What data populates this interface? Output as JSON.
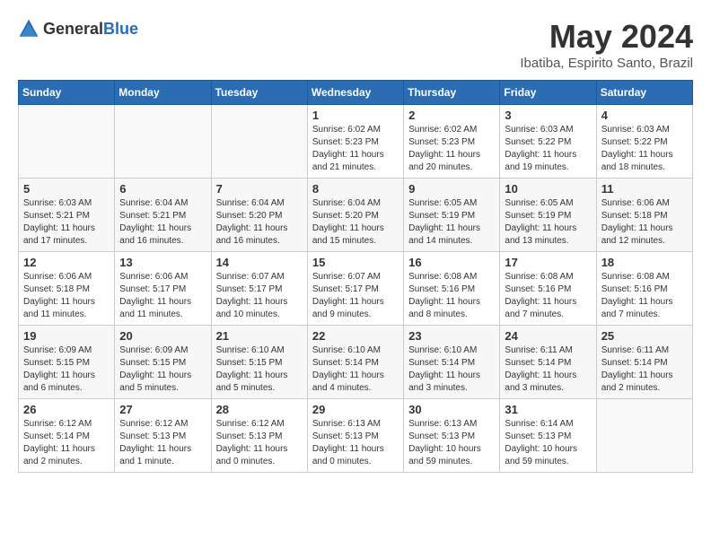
{
  "header": {
    "logo_general": "General",
    "logo_blue": "Blue",
    "title": "May 2024",
    "location": "Ibatiba, Espirito Santo, Brazil"
  },
  "calendar": {
    "days_of_week": [
      "Sunday",
      "Monday",
      "Tuesday",
      "Wednesday",
      "Thursday",
      "Friday",
      "Saturday"
    ],
    "weeks": [
      [
        {
          "day": "",
          "info": ""
        },
        {
          "day": "",
          "info": ""
        },
        {
          "day": "",
          "info": ""
        },
        {
          "day": "1",
          "info": "Sunrise: 6:02 AM\nSunset: 5:23 PM\nDaylight: 11 hours\nand 21 minutes."
        },
        {
          "day": "2",
          "info": "Sunrise: 6:02 AM\nSunset: 5:23 PM\nDaylight: 11 hours\nand 20 minutes."
        },
        {
          "day": "3",
          "info": "Sunrise: 6:03 AM\nSunset: 5:22 PM\nDaylight: 11 hours\nand 19 minutes."
        },
        {
          "day": "4",
          "info": "Sunrise: 6:03 AM\nSunset: 5:22 PM\nDaylight: 11 hours\nand 18 minutes."
        }
      ],
      [
        {
          "day": "5",
          "info": "Sunrise: 6:03 AM\nSunset: 5:21 PM\nDaylight: 11 hours\nand 17 minutes."
        },
        {
          "day": "6",
          "info": "Sunrise: 6:04 AM\nSunset: 5:21 PM\nDaylight: 11 hours\nand 16 minutes."
        },
        {
          "day": "7",
          "info": "Sunrise: 6:04 AM\nSunset: 5:20 PM\nDaylight: 11 hours\nand 16 minutes."
        },
        {
          "day": "8",
          "info": "Sunrise: 6:04 AM\nSunset: 5:20 PM\nDaylight: 11 hours\nand 15 minutes."
        },
        {
          "day": "9",
          "info": "Sunrise: 6:05 AM\nSunset: 5:19 PM\nDaylight: 11 hours\nand 14 minutes."
        },
        {
          "day": "10",
          "info": "Sunrise: 6:05 AM\nSunset: 5:19 PM\nDaylight: 11 hours\nand 13 minutes."
        },
        {
          "day": "11",
          "info": "Sunrise: 6:06 AM\nSunset: 5:18 PM\nDaylight: 11 hours\nand 12 minutes."
        }
      ],
      [
        {
          "day": "12",
          "info": "Sunrise: 6:06 AM\nSunset: 5:18 PM\nDaylight: 11 hours\nand 11 minutes."
        },
        {
          "day": "13",
          "info": "Sunrise: 6:06 AM\nSunset: 5:17 PM\nDaylight: 11 hours\nand 11 minutes."
        },
        {
          "day": "14",
          "info": "Sunrise: 6:07 AM\nSunset: 5:17 PM\nDaylight: 11 hours\nand 10 minutes."
        },
        {
          "day": "15",
          "info": "Sunrise: 6:07 AM\nSunset: 5:17 PM\nDaylight: 11 hours\nand 9 minutes."
        },
        {
          "day": "16",
          "info": "Sunrise: 6:08 AM\nSunset: 5:16 PM\nDaylight: 11 hours\nand 8 minutes."
        },
        {
          "day": "17",
          "info": "Sunrise: 6:08 AM\nSunset: 5:16 PM\nDaylight: 11 hours\nand 7 minutes."
        },
        {
          "day": "18",
          "info": "Sunrise: 6:08 AM\nSunset: 5:16 PM\nDaylight: 11 hours\nand 7 minutes."
        }
      ],
      [
        {
          "day": "19",
          "info": "Sunrise: 6:09 AM\nSunset: 5:15 PM\nDaylight: 11 hours\nand 6 minutes."
        },
        {
          "day": "20",
          "info": "Sunrise: 6:09 AM\nSunset: 5:15 PM\nDaylight: 11 hours\nand 5 minutes."
        },
        {
          "day": "21",
          "info": "Sunrise: 6:10 AM\nSunset: 5:15 PM\nDaylight: 11 hours\nand 5 minutes."
        },
        {
          "day": "22",
          "info": "Sunrise: 6:10 AM\nSunset: 5:14 PM\nDaylight: 11 hours\nand 4 minutes."
        },
        {
          "day": "23",
          "info": "Sunrise: 6:10 AM\nSunset: 5:14 PM\nDaylight: 11 hours\nand 3 minutes."
        },
        {
          "day": "24",
          "info": "Sunrise: 6:11 AM\nSunset: 5:14 PM\nDaylight: 11 hours\nand 3 minutes."
        },
        {
          "day": "25",
          "info": "Sunrise: 6:11 AM\nSunset: 5:14 PM\nDaylight: 11 hours\nand 2 minutes."
        }
      ],
      [
        {
          "day": "26",
          "info": "Sunrise: 6:12 AM\nSunset: 5:14 PM\nDaylight: 11 hours\nand 2 minutes."
        },
        {
          "day": "27",
          "info": "Sunrise: 6:12 AM\nSunset: 5:13 PM\nDaylight: 11 hours\nand 1 minute."
        },
        {
          "day": "28",
          "info": "Sunrise: 6:12 AM\nSunset: 5:13 PM\nDaylight: 11 hours\nand 0 minutes."
        },
        {
          "day": "29",
          "info": "Sunrise: 6:13 AM\nSunset: 5:13 PM\nDaylight: 11 hours\nand 0 minutes."
        },
        {
          "day": "30",
          "info": "Sunrise: 6:13 AM\nSunset: 5:13 PM\nDaylight: 10 hours\nand 59 minutes."
        },
        {
          "day": "31",
          "info": "Sunrise: 6:14 AM\nSunset: 5:13 PM\nDaylight: 10 hours\nand 59 minutes."
        },
        {
          "day": "",
          "info": ""
        }
      ]
    ]
  }
}
